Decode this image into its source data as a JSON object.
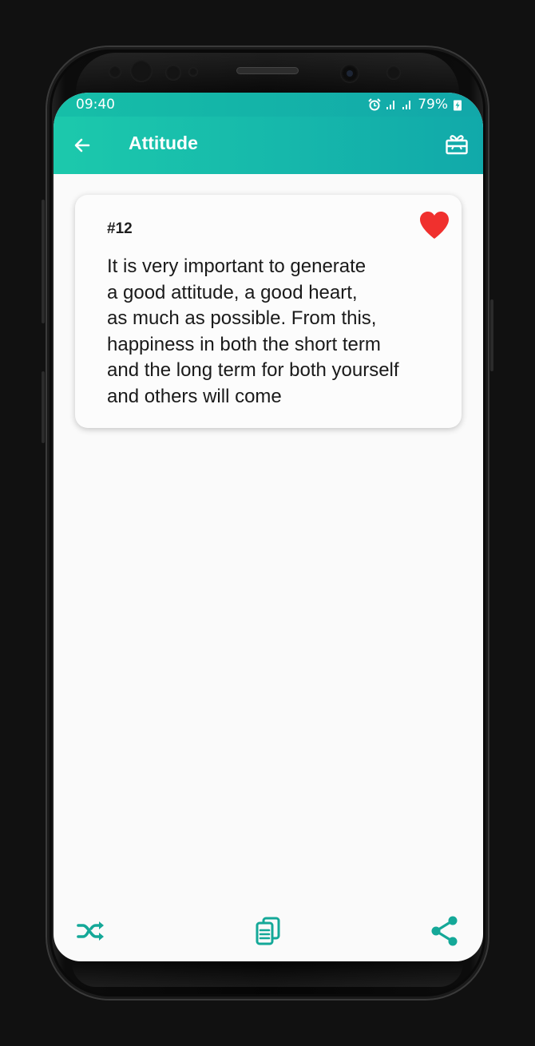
{
  "status_bar": {
    "time": "09:40",
    "battery": "79%",
    "icons": [
      "alarm-icon",
      "signal-icon",
      "signal-icon",
      "battery-charging-icon"
    ]
  },
  "app_bar": {
    "title": "Attitude",
    "back_icon": "arrow-left-icon",
    "gift_icon": "gift-icon"
  },
  "quote": {
    "number": "#12",
    "text": "It is very important to generate\na good attitude, a good heart,\nas much as possible. From this,\nhappiness in both the short term\nand the long term for both yourself\nand others will come",
    "favorite": true,
    "favorite_icon": "heart-icon"
  },
  "bottom_bar": {
    "shuffle_icon": "shuffle-icon",
    "copy_icon": "copy-icon",
    "share_icon": "share-icon"
  },
  "colors": {
    "accent_start": "#1cc9ac",
    "accent_end": "#11a9aa",
    "heart": "#f0302e",
    "icon_teal": "#14a898"
  }
}
